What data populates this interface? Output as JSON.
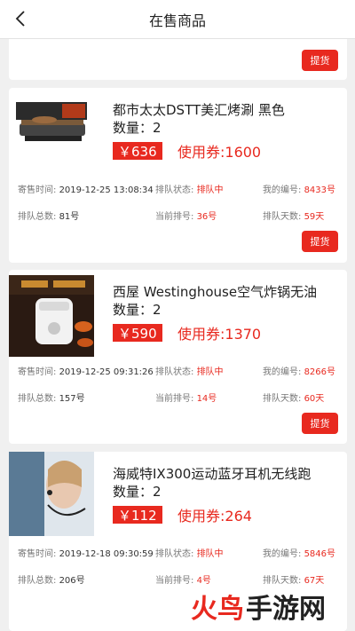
{
  "header": {
    "title": "在售商品"
  },
  "cards": [
    {
      "button": "提货"
    },
    {
      "name": "都市太太DSTT美汇烤涮 黑色",
      "qty": "数量：2",
      "price": "￥636",
      "coupon": "使用券:1600",
      "consign_label": "寄售时间:",
      "consign_time": "2019-12-25 13:08:34",
      "queue_status_label": "排队状态:",
      "queue_status": "排队中",
      "my_no_label": "我的编号:",
      "my_no": "8433号",
      "queue_total_label": "排队总数:",
      "queue_total": "81号",
      "cur_no_label": "当前排号:",
      "cur_no": "36号",
      "queue_days_label": "排队天数:",
      "queue_days": "59天",
      "button": "提货"
    },
    {
      "name": "西屋 Westinghouse空气炸锅无油",
      "qty": "数量：2",
      "price": "￥590",
      "coupon": "使用券:1370",
      "consign_label": "寄售时间:",
      "consign_time": "2019-12-25 09:31:26",
      "queue_status_label": "排队状态:",
      "queue_status": "排队中",
      "my_no_label": "我的编号:",
      "my_no": "8266号",
      "queue_total_label": "排队总数:",
      "queue_total": "157号",
      "cur_no_label": "当前排号:",
      "cur_no": "14号",
      "queue_days_label": "排队天数:",
      "queue_days": "60天",
      "button": "提货"
    },
    {
      "name": "海威特IX300运动蓝牙耳机无线跑",
      "qty": "数量：2",
      "price": "￥112",
      "coupon": "使用券:264",
      "consign_label": "寄售时间:",
      "consign_time": "2019-12-18 09:30:59",
      "queue_status_label": "排队状态:",
      "queue_status": "排队中",
      "my_no_label": "我的编号:",
      "my_no": "5846号",
      "queue_total_label": "排队总数:",
      "queue_total": "206号",
      "cur_no_label": "当前排号:",
      "cur_no": "4号",
      "queue_days_label": "排队天数:",
      "queue_days": "67天"
    }
  ],
  "watermark": {
    "part1": "火鸟",
    "part2": "手游网"
  },
  "colors": {
    "accent": "#e8291f",
    "background": "#f0f0f0"
  }
}
